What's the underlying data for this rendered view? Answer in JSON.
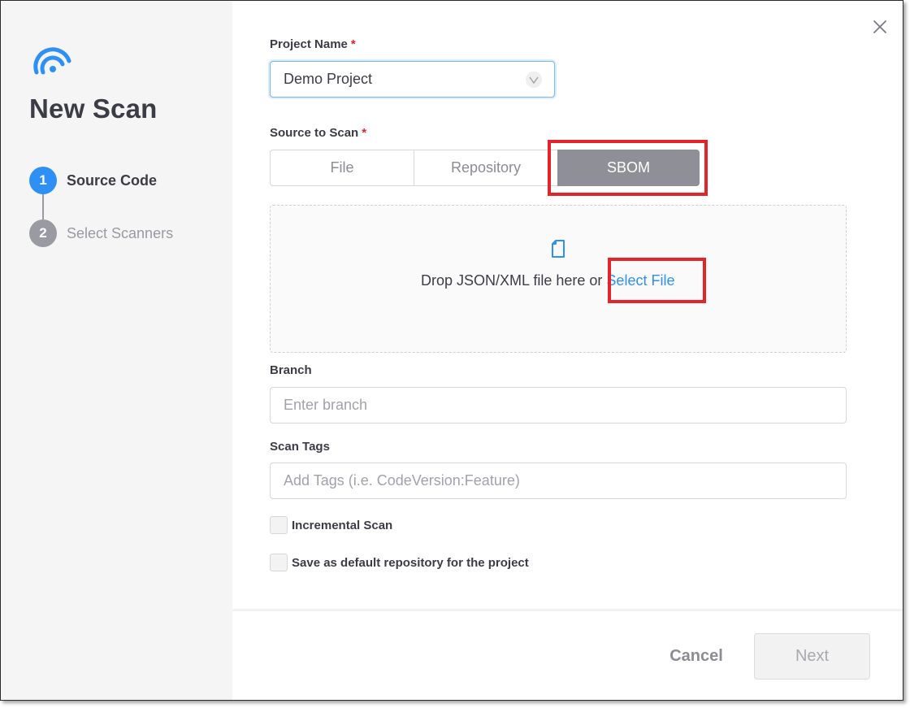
{
  "sidebar": {
    "title": "New Scan",
    "steps": [
      {
        "number": "1",
        "label": "Source Code",
        "state": "active"
      },
      {
        "number": "2",
        "label": "Select Scanners",
        "state": "inactive"
      }
    ]
  },
  "form": {
    "project_name": {
      "label": "Project Name",
      "required_mark": "*",
      "value": "Demo Project"
    },
    "source": {
      "label": "Source to Scan",
      "required_mark": "*",
      "options": [
        "File",
        "Repository",
        "SBOM"
      ],
      "selected": "SBOM"
    },
    "dropzone": {
      "text": "Drop JSON/XML file here or ",
      "link": "Select File"
    },
    "branch": {
      "label": "Branch",
      "placeholder": "Enter branch"
    },
    "tags": {
      "label": "Scan Tags",
      "placeholder": "Add Tags (i.e. CodeVersion:Feature)"
    },
    "checkboxes": [
      {
        "label": "Incremental Scan",
        "checked": false
      },
      {
        "label": "Save as default repository for the project",
        "checked": false
      }
    ]
  },
  "footer": {
    "cancel_label": "Cancel",
    "next_label": "Next"
  },
  "colors": {
    "accent": "#2e90f5",
    "highlight": "#e3242b",
    "selected_segment": "#8f8f98"
  },
  "icons": {
    "logo": "radar-logo-icon",
    "close": "close-icon",
    "dropdown": "chevron-down-icon",
    "file": "document-icon"
  }
}
